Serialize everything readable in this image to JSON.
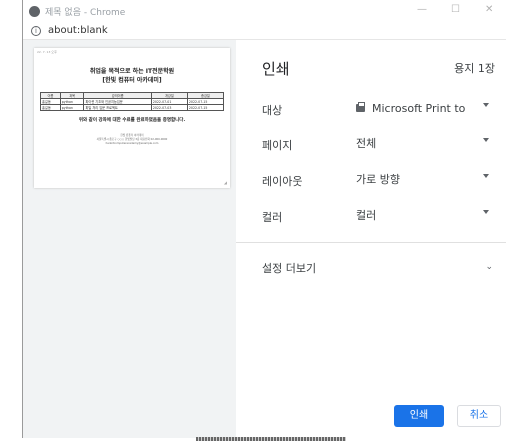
{
  "window": {
    "title": "제목 없음 - Chrome",
    "url": "about:blank",
    "controls": {
      "minimize": "—",
      "maximize": "☐",
      "close": "✕"
    }
  },
  "preview": {
    "corner_text": "22. 7. 13 오후",
    "title_line1": "취업을 목적으로 하는 IT전문학원",
    "title_line2": "[한빛 컴퓨터 아카데미]",
    "table_headers": [
      "이름",
      "과목",
      "강의이름",
      "개강일",
      "종강일"
    ],
    "table_rows": [
      [
        "홍길동",
        "python",
        "파이썬 기초와 인공지능입문",
        "2022-07-01",
        "2022-07-15"
      ],
      [
        "홍길동",
        "python",
        "파일 처리 입문 프로젝트",
        "2022-07-03",
        "2022-07-15"
      ]
    ],
    "message": "위와 같이 강좌에 대한 수료를 완료하였음을 증명합니다.",
    "footer_line1": "한빛 컴퓨터 아카데미",
    "footer_line2": "서울특별시 종로구 ○○○ 한빛빌딩 3층 대표전화 02-000-0000",
    "footer_line3": "hanbitcomputeracademy@example.com"
  },
  "print_panel": {
    "title": "인쇄",
    "sheet_count": "용지 1장",
    "rows": {
      "destination": {
        "label": "대상",
        "value": "Microsoft Print to"
      },
      "pages": {
        "label": "페이지",
        "value": "전체"
      },
      "layout": {
        "label": "레이아웃",
        "value": "가로 방향"
      },
      "color": {
        "label": "컬러",
        "value": "컬러"
      }
    },
    "more_settings": "설정 더보기",
    "print_button": "인쇄",
    "cancel_button": "취소"
  },
  "colors": {
    "accent": "#1a73e8",
    "preview_bg": "#f1f3f4"
  }
}
